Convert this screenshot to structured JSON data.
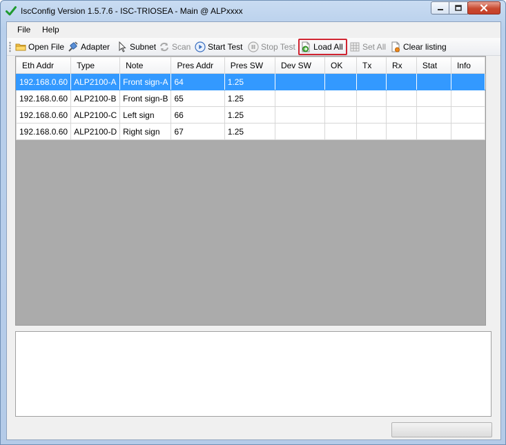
{
  "window": {
    "title": "IscConfig Version 1.5.7.6 - ISC-TRIOSEA - Main @ ALPxxxx"
  },
  "menu": {
    "items": [
      {
        "label": "File"
      },
      {
        "label": "Help"
      }
    ]
  },
  "toolbar": {
    "buttons": [
      {
        "label": "Open File",
        "icon": "folder-icon",
        "enabled": true
      },
      {
        "label": "Adapter",
        "icon": "network-adapter-icon",
        "enabled": true
      },
      {
        "label": "Subnet",
        "icon": "cursor-arrow-icon",
        "enabled": true
      },
      {
        "label": "Scan",
        "icon": "refresh-icon",
        "enabled": false
      },
      {
        "label": "Start Test",
        "icon": "play-icon",
        "enabled": true
      },
      {
        "label": "Stop Test",
        "icon": "stop-icon",
        "enabled": false
      },
      {
        "label": "Load All",
        "icon": "load-document-icon",
        "enabled": true
      },
      {
        "label": "Set All",
        "icon": "table-grid-icon",
        "enabled": false
      },
      {
        "label": "Clear listing",
        "icon": "clear-document-icon",
        "enabled": true
      }
    ]
  },
  "grid": {
    "columns": [
      "Eth Addr",
      "Type",
      "Note",
      "Pres Addr",
      "Pres SW",
      "Dev SW",
      "OK",
      "Tx",
      "Rx",
      "Stat",
      "Info"
    ],
    "rows": [
      [
        "192.168.0.60",
        "ALP2100-A",
        "Front sign-A",
        "64",
        "1.25",
        "",
        "",
        "",
        "",
        "",
        ""
      ],
      [
        "192.168.0.60",
        "ALP2100-B",
        "Front sign-B",
        "65",
        "1.25",
        "",
        "",
        "",
        "",
        "",
        ""
      ],
      [
        "192.168.0.60",
        "ALP2100-C",
        "Left sign",
        "66",
        "1.25",
        "",
        "",
        "",
        "",
        "",
        ""
      ],
      [
        "192.168.0.60",
        "ALP2100-D",
        "Right sign",
        "67",
        "1.25",
        "",
        "",
        "",
        "",
        "",
        ""
      ]
    ],
    "selected_row": 0
  },
  "log": {
    "text": ""
  },
  "progress": {
    "value": 0
  },
  "colors": {
    "selection": "#3399ff",
    "highlight_outline": "#d0232f",
    "grid_background": "#ababab"
  }
}
